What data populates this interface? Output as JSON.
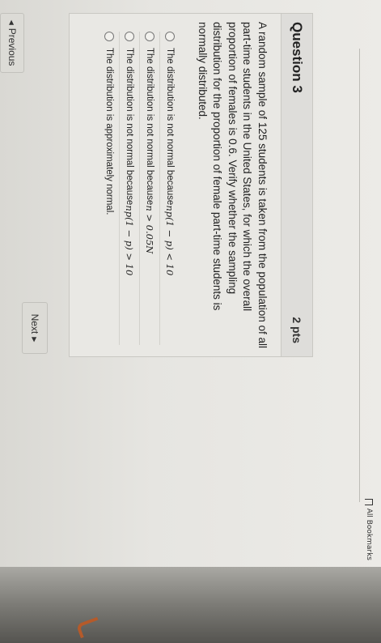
{
  "browser": {
    "bookmarks_label": "All Bookmarks"
  },
  "question": {
    "title": "Question 3",
    "points": "2 pts",
    "text": "A random sample of 125 students is taken from the population of all part-time students in the United States, for which the overall proportion of females is 0.6. Verify whether the sampling distribution for the proportion of female part-time students is normally distributed.",
    "answers": [
      {
        "prefix": "The distribution is not normal because ",
        "math": "np(1 − p) < 10"
      },
      {
        "prefix": "The distribution is not normal because ",
        "math": "n > 0.05N"
      },
      {
        "prefix": "The distribution is not normal because ",
        "math": "np(1 − p) > 10"
      },
      {
        "prefix": "The distribution is approximately normal.",
        "math": ""
      }
    ]
  },
  "nav": {
    "next_label": "Next",
    "previous_label": "Previous"
  }
}
